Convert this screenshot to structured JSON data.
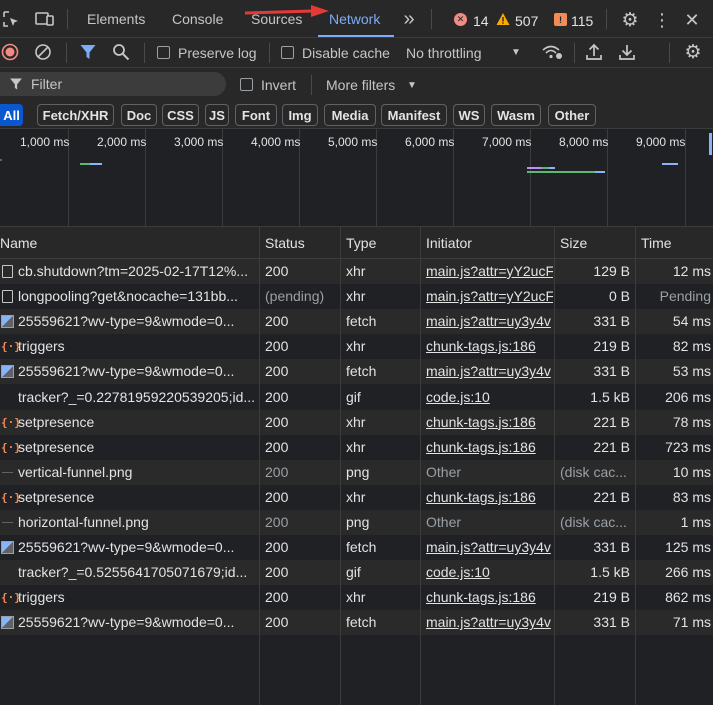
{
  "tabs": {
    "items": [
      "Elements",
      "Console",
      "Sources",
      "Network"
    ],
    "active": "Network",
    "more": "»"
  },
  "counters": {
    "errors": "14",
    "warnings": "507",
    "issues": "115"
  },
  "colors": {
    "accent": "#7cacf8",
    "error": "#f28b82",
    "warning": "#f9ab00",
    "issue": "#f28b54",
    "chip_active": "#0b57d0"
  },
  "toolbar": {
    "preserve_log": "Preserve log",
    "disable_cache": "Disable cache",
    "throttling": "No throttling"
  },
  "filterbar": {
    "filter_placeholder": "Filter",
    "invert": "Invert",
    "more_filters": "More filters"
  },
  "type_filters": [
    "All",
    "Fetch/XHR",
    "Doc",
    "CSS",
    "JS",
    "Font",
    "Img",
    "Media",
    "Manifest",
    "WS",
    "Wasm",
    "Other"
  ],
  "overview": {
    "ticks": [
      "1,000 ms",
      "2,000 ms",
      "3,000 ms",
      "4,000 ms",
      "5,000 ms",
      "6,000 ms",
      "7,000 ms",
      "8,000 ms",
      "9,000 ms"
    ]
  },
  "table": {
    "columns": [
      "Name",
      "Status",
      "Type",
      "Initiator",
      "Size",
      "Time"
    ],
    "rows": [
      {
        "icon": "doc",
        "name": "cb.shutdown?tm=2025-02-17T12%...",
        "status": "200",
        "type": "xhr",
        "initiator": "main.js?attr=yY2ucF",
        "size": "129 B",
        "time": "12 ms"
      },
      {
        "icon": "doc",
        "name": "longpooling?get&nocache=131bb...",
        "status": "(pending)",
        "type": "xhr",
        "initiator": "main.js?attr=yY2ucF",
        "size": "0 B",
        "time": "Pending"
      },
      {
        "icon": "img",
        "name": "25559621?wv-type=9&wmode=0...",
        "status": "200",
        "type": "fetch",
        "initiator": "main.js?attr=uy3y4v",
        "size": "331 B",
        "time": "54 ms"
      },
      {
        "icon": "xhr",
        "name": "triggers",
        "status": "200",
        "type": "xhr",
        "initiator": "chunk-tags.js:186",
        "size": "219 B",
        "time": "82 ms"
      },
      {
        "icon": "img",
        "name": "25559621?wv-type=9&wmode=0...",
        "status": "200",
        "type": "fetch",
        "initiator": "main.js?attr=uy3y4v",
        "size": "331 B",
        "time": "53 ms"
      },
      {
        "icon": "none",
        "name": "tracker?_=0.22781959220539205;id...",
        "status": "200",
        "type": "gif",
        "initiator": "code.js:10",
        "size": "1.5 kB",
        "time": "206 ms"
      },
      {
        "icon": "xhr",
        "name": "setpresence",
        "status": "200",
        "type": "xhr",
        "initiator": "chunk-tags.js:186",
        "size": "221 B",
        "time": "78 ms"
      },
      {
        "icon": "xhr",
        "name": "setpresence",
        "status": "200",
        "type": "xhr",
        "initiator": "chunk-tags.js:186",
        "size": "221 B",
        "time": "723 ms"
      },
      {
        "icon": "png",
        "name": "vertical-funnel.png",
        "status": "200",
        "type": "png",
        "initiator": "Other",
        "size": "(disk cac...",
        "time": "10 ms"
      },
      {
        "icon": "xhr",
        "name": "setpresence",
        "status": "200",
        "type": "xhr",
        "initiator": "chunk-tags.js:186",
        "size": "221 B",
        "time": "83 ms"
      },
      {
        "icon": "png",
        "name": "horizontal-funnel.png",
        "status": "200",
        "type": "png",
        "initiator": "Other",
        "size": "(disk cac...",
        "time": "1 ms"
      },
      {
        "icon": "img",
        "name": "25559621?wv-type=9&wmode=0...",
        "status": "200",
        "type": "fetch",
        "initiator": "main.js?attr=uy3y4v",
        "size": "331 B",
        "time": "125 ms"
      },
      {
        "icon": "none",
        "name": "tracker?_=0.5255641705071679;id...",
        "status": "200",
        "type": "gif",
        "initiator": "code.js:10",
        "size": "1.5 kB",
        "time": "266 ms"
      },
      {
        "icon": "xhr",
        "name": "triggers",
        "status": "200",
        "type": "xhr",
        "initiator": "chunk-tags.js:186",
        "size": "219 B",
        "time": "862 ms"
      },
      {
        "icon": "img",
        "name": "25559621?wv-type=9&wmode=0...",
        "status": "200",
        "type": "fetch",
        "initiator": "main.js?attr=uy3y4v",
        "size": "331 B",
        "time": "71 ms"
      }
    ]
  }
}
